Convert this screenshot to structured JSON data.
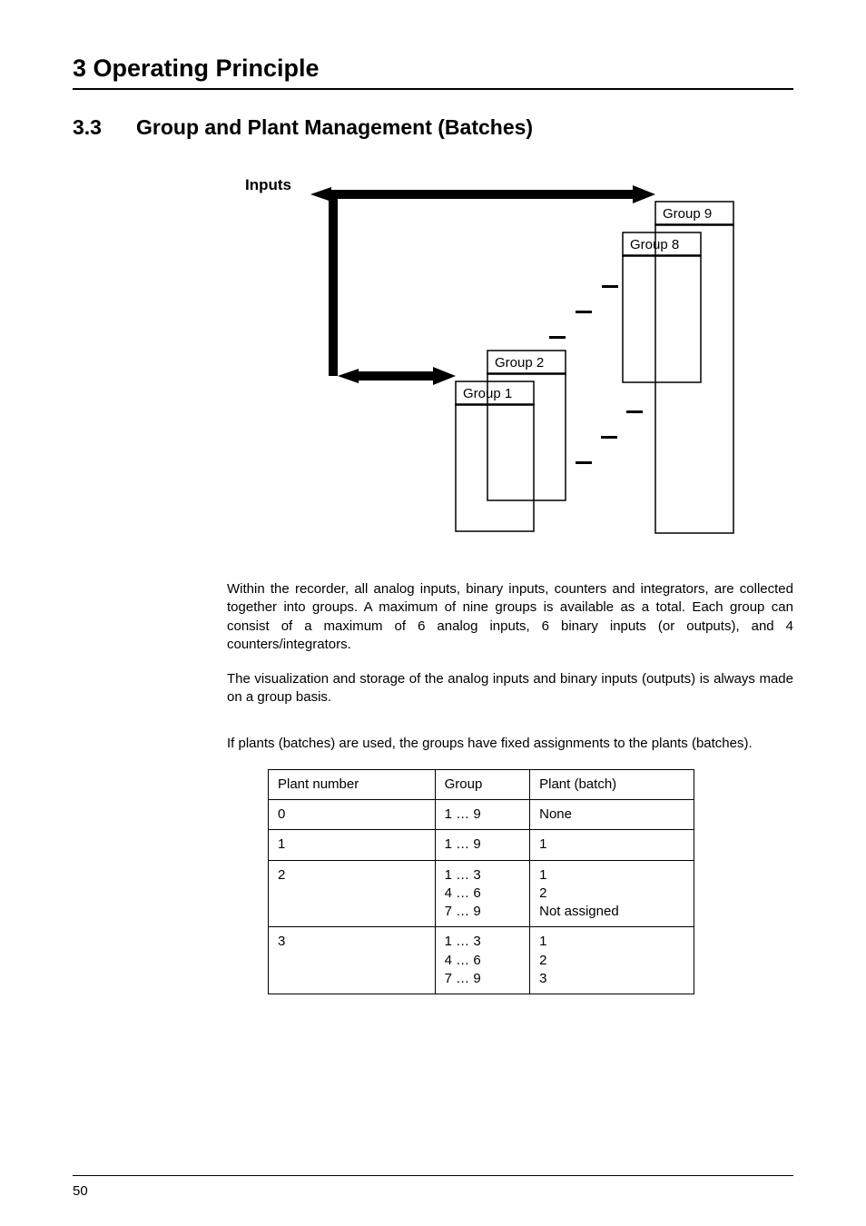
{
  "chapter_title": "3 Operating Principle",
  "section_num": "3.3",
  "section_title": "Group and Plant Management (Batches)",
  "diagram": {
    "inputs_label": "Inputs",
    "group1": "Group 1",
    "group2": "Group 2",
    "group8": "Group 8",
    "group9": "Group 9"
  },
  "para1": "Within the recorder, all analog inputs, binary inputs, counters and integrators, are collected together into groups. A maximum of nine groups is available as a total. Each group can consist of a maximum of 6 analog inputs, 6 binary inputs (or outputs), and 4 counters/integrators.",
  "para2": "The visualization and storage of the analog inputs and binary inputs (outputs) is always made on a group basis.",
  "para3": "If plants (batches) are used, the groups have fixed assignments to the plants (batches).",
  "table": {
    "h1": "Plant number",
    "h2": "Group",
    "h3": "Plant (batch)",
    "rows": [
      {
        "c1": "0",
        "c2": "1 … 9",
        "c3": "None"
      },
      {
        "c1": "1",
        "c2": "1 … 9",
        "c3": "1"
      },
      {
        "c1": "2",
        "c2": "1 … 3\n4 … 6\n7 … 9",
        "c3": "1\n2\nNot assigned"
      },
      {
        "c1": "3",
        "c2": "1 … 3\n4 … 6\n7 … 9",
        "c3": "1\n2\n3"
      }
    ]
  },
  "page_number": "50"
}
